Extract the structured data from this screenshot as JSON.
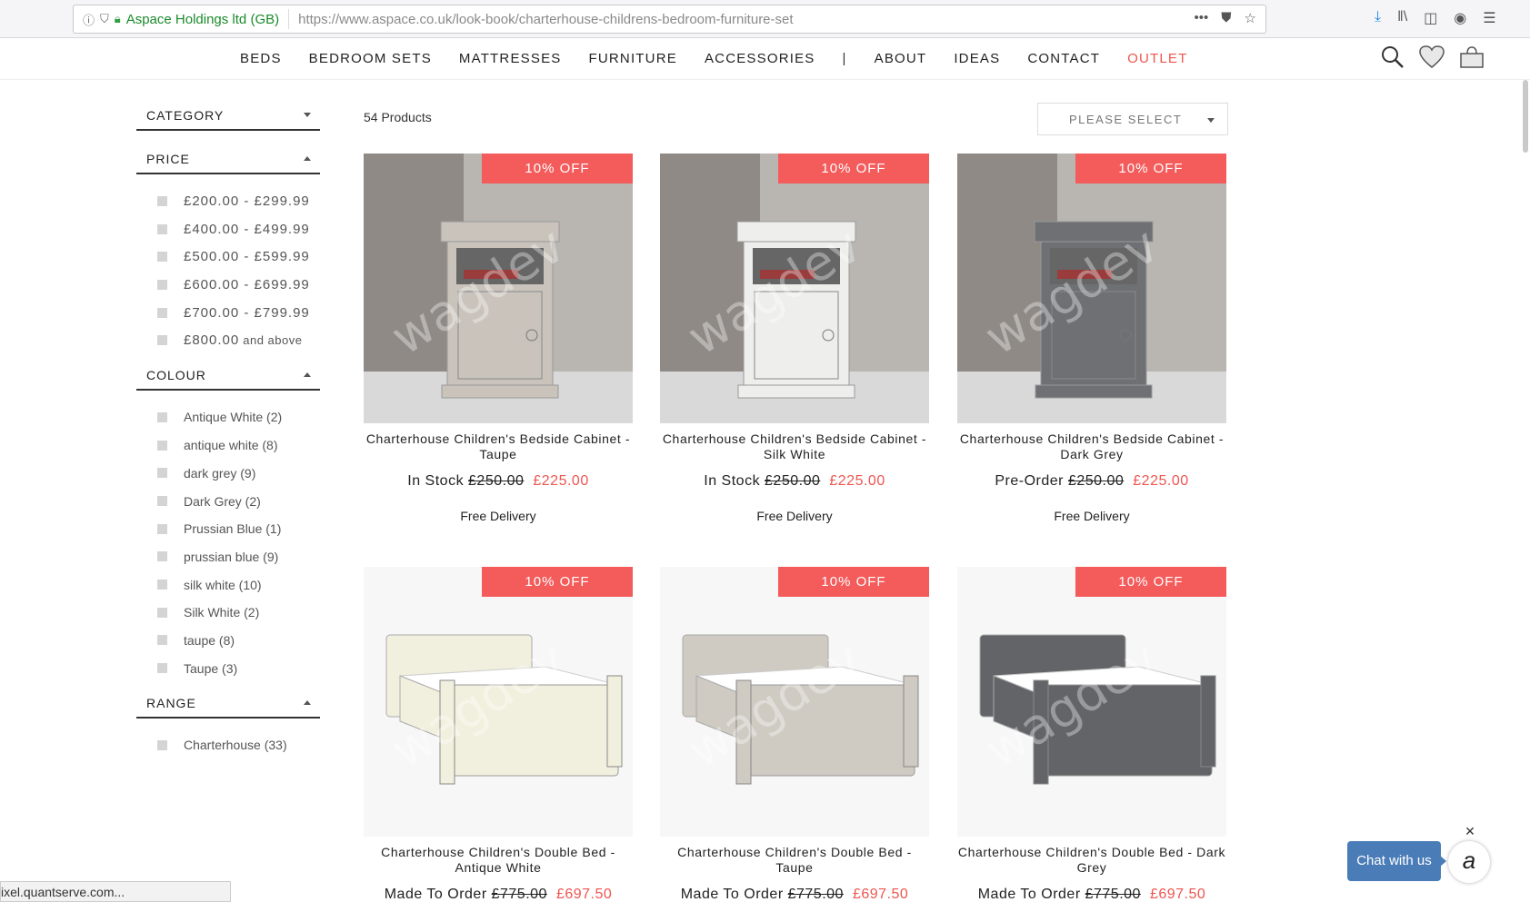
{
  "browser": {
    "site_identity": "Aspace Holdings ltd (GB)",
    "url": "https://www.aspace.co.uk/look-book/charterhouse-childrens-bedroom-furniture-set",
    "status_text": "ixel.quantserve.com..."
  },
  "nav": {
    "items": [
      "BEDS",
      "BEDROOM SETS",
      "MATTRESSES",
      "FURNITURE",
      "ACCESSORIES"
    ],
    "separator": "|",
    "items2": [
      "ABOUT",
      "IDEAS",
      "CONTACT"
    ],
    "outlet": "OUTLET",
    "icons": [
      "search-icon",
      "heart-icon",
      "basket-icon"
    ]
  },
  "sidebar": {
    "category": "CATEGORY",
    "price": {
      "heading": "PRICE",
      "items": [
        {
          "label": "£200.00 - £299.99",
          "suffix": ""
        },
        {
          "label": "£400.00 - £499.99",
          "suffix": ""
        },
        {
          "label": "£500.00 - £599.99",
          "suffix": ""
        },
        {
          "label": "£600.00 - £699.99",
          "suffix": ""
        },
        {
          "label": "£700.00 - £799.99",
          "suffix": ""
        },
        {
          "label": "£800.00",
          "suffix": "and above"
        }
      ]
    },
    "colour": {
      "heading": "COLOUR",
      "items": [
        "Antique White (2)",
        "antique white (8)",
        "dark grey (9)",
        "Dark Grey (2)",
        "Prussian Blue (1)",
        "prussian blue (9)",
        "silk white (10)",
        "Silk White (2)",
        "taupe (8)",
        "Taupe (3)"
      ]
    },
    "range": {
      "heading": "RANGE",
      "items": [
        "Charterhouse (33)"
      ]
    }
  },
  "main": {
    "count": "54 Products",
    "sort_label": "PLEASE SELECT",
    "badge": "10% OFF",
    "watermark": "wagdev",
    "products": [
      {
        "title": "Charterhouse Children's Bedside Cabinet - Taupe",
        "stock": "In Stock",
        "old_price": "£250.00",
        "new_price": "£225.00",
        "delivery": "Free Delivery",
        "kind": "cabinet",
        "colour": "#c9c3bb"
      },
      {
        "title": "Charterhouse Children's Bedside Cabinet - Silk White",
        "stock": "In Stock",
        "old_price": "£250.00",
        "new_price": "£225.00",
        "delivery": "Free Delivery",
        "kind": "cabinet",
        "colour": "#eeeeec"
      },
      {
        "title": "Charterhouse Children's Bedside Cabinet - Dark Grey",
        "stock": "Pre-Order",
        "old_price": "£250.00",
        "new_price": "£225.00",
        "delivery": "Free Delivery",
        "kind": "cabinet",
        "colour": "#6f7073"
      },
      {
        "title": "Charterhouse Children's Double Bed - Antique White",
        "stock": "Made To Order",
        "old_price": "£775.00",
        "new_price": "£697.50",
        "delivery": "",
        "kind": "bed",
        "colour": "#f1f0de"
      },
      {
        "title": "Charterhouse Children's Double Bed - Taupe",
        "stock": "Made To Order",
        "old_price": "£775.00",
        "new_price": "£697.50",
        "delivery": "",
        "kind": "bed",
        "colour": "#cfcac2"
      },
      {
        "title": "Charterhouse Children's Double Bed - Dark Grey",
        "stock": "Made To Order",
        "old_price": "£775.00",
        "new_price": "£697.50",
        "delivery": "",
        "kind": "bed",
        "colour": "#636467"
      }
    ]
  },
  "chat": {
    "label": "Chat with us",
    "close": "✕",
    "avatar": "a"
  },
  "colors": {
    "accent": "#f45b5b",
    "price_red": "#f0554f",
    "chat_blue": "#4a7db8"
  }
}
